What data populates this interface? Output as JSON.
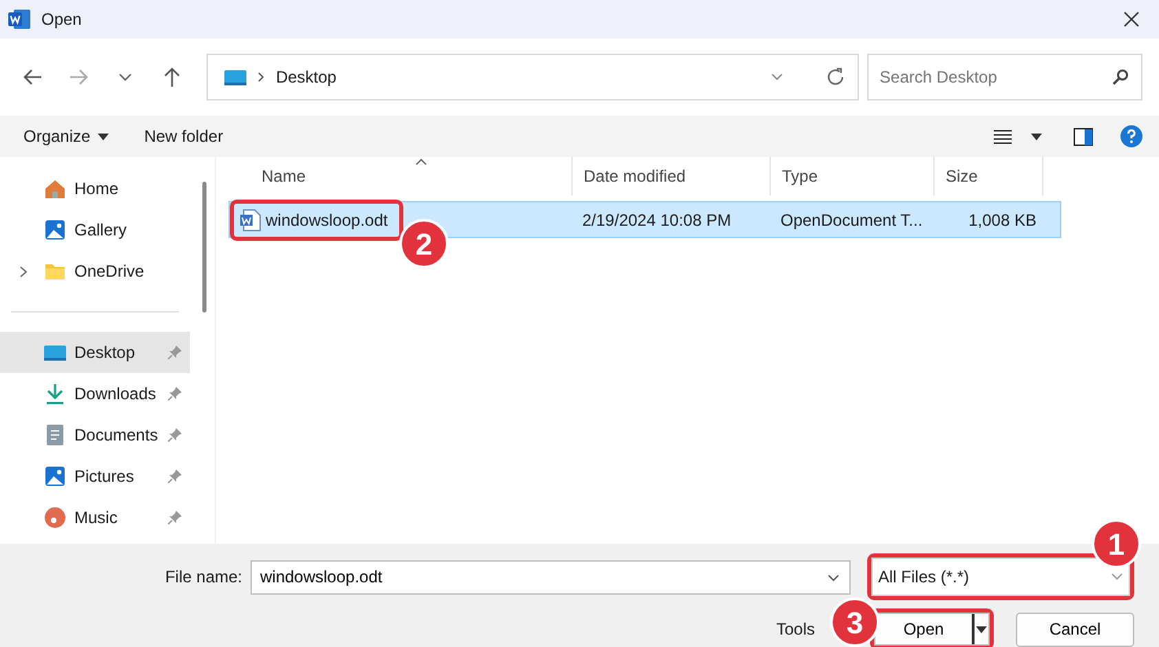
{
  "window": {
    "title": "Open"
  },
  "address": {
    "path": [
      {
        "label": "Desktop"
      }
    ]
  },
  "search": {
    "placeholder": "Search Desktop"
  },
  "toolbar": {
    "organize": "Organize",
    "new_folder": "New folder"
  },
  "sidebar": {
    "groups": [
      {
        "items": [
          {
            "label": "Home",
            "pinned": false,
            "selected": false,
            "expandable": false
          },
          {
            "label": "Gallery",
            "pinned": false,
            "selected": false,
            "expandable": false
          },
          {
            "label": "OneDrive",
            "pinned": false,
            "selected": false,
            "expandable": true
          }
        ]
      },
      {
        "items": [
          {
            "label": "Desktop",
            "pinned": true,
            "selected": true,
            "expandable": false
          },
          {
            "label": "Downloads",
            "pinned": true,
            "selected": false,
            "expandable": false
          },
          {
            "label": "Documents",
            "pinned": true,
            "selected": false,
            "expandable": false
          },
          {
            "label": "Pictures",
            "pinned": true,
            "selected": false,
            "expandable": false
          },
          {
            "label": "Music",
            "pinned": true,
            "selected": false,
            "expandable": false
          }
        ]
      }
    ]
  },
  "table": {
    "columns": [
      "Name",
      "Date modified",
      "Type",
      "Size"
    ],
    "rows": [
      {
        "name": "windowsloop.odt",
        "date": "2/19/2024 10:08 PM",
        "type": "OpenDocument T...",
        "size": "1,008 KB",
        "selected": true,
        "callout": "2"
      }
    ]
  },
  "footer": {
    "file_name_label": "File name:",
    "file_name": "windowsloop.odt",
    "filter": "All Files (*.*)",
    "filter_callout": "1",
    "tools": "Tools",
    "open": "Open",
    "open_callout": "3",
    "cancel": "Cancel"
  }
}
